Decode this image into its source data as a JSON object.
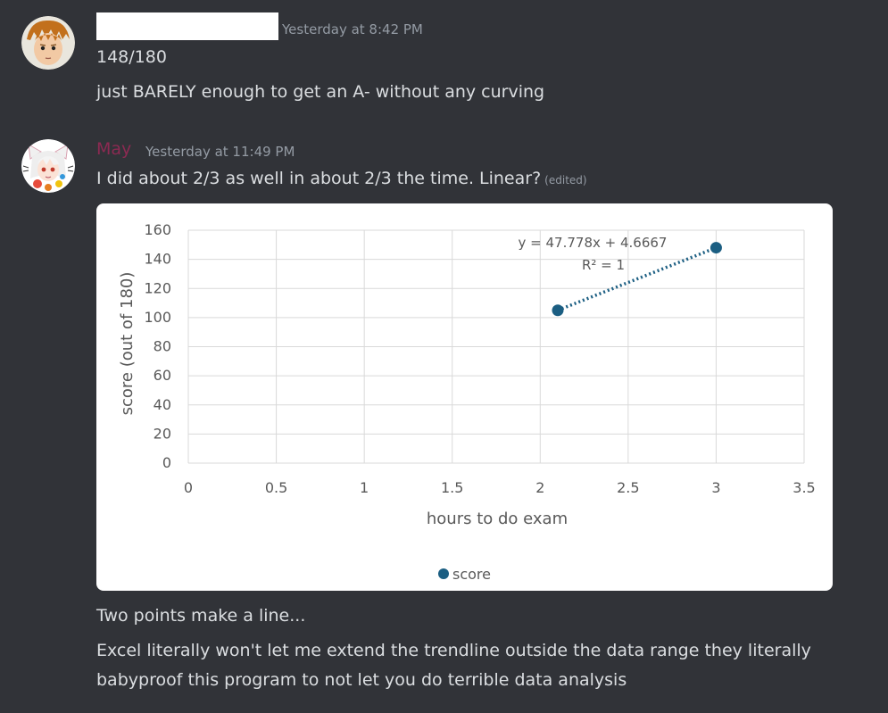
{
  "messages": [
    {
      "timestamp": "Yesterday at 8:42 PM",
      "lines": [
        "148/180",
        "just BARELY enough to get an A- without any curving"
      ]
    },
    {
      "username": "May",
      "username_color": "#8c2a52",
      "timestamp": "Yesterday at 11:49 PM",
      "line1": "I did about 2/3 as well in about 2/3 the time. Linear?",
      "edited_label": "(edited)",
      "lines_after": [
        "Two points make a line...",
        "Excel literally won't let me extend the trendline outside the data range they literally",
        "babyproof this program to not let you do terrible data analysis"
      ]
    }
  ],
  "chart_data": {
    "type": "scatter",
    "series": [
      {
        "name": "score",
        "color": "#1b5e82",
        "x": [
          2.1,
          3
        ],
        "y": [
          105,
          148
        ]
      }
    ],
    "xlabel": "hours to do exam",
    "ylabel": "score (out of 180)",
    "xlim": [
      0,
      3.5
    ],
    "ylim": [
      0,
      160
    ],
    "xticks": [
      0,
      0.5,
      1,
      1.5,
      2,
      2.5,
      3,
      3.5
    ],
    "yticks": [
      0,
      20,
      40,
      60,
      80,
      100,
      120,
      140,
      160
    ],
    "trendline": {
      "type": "linear",
      "equation": "y = 47.778x + 4.6667",
      "r_squared": "R² = 1",
      "style": "dotted"
    },
    "grid": true,
    "legend": "bottom"
  }
}
